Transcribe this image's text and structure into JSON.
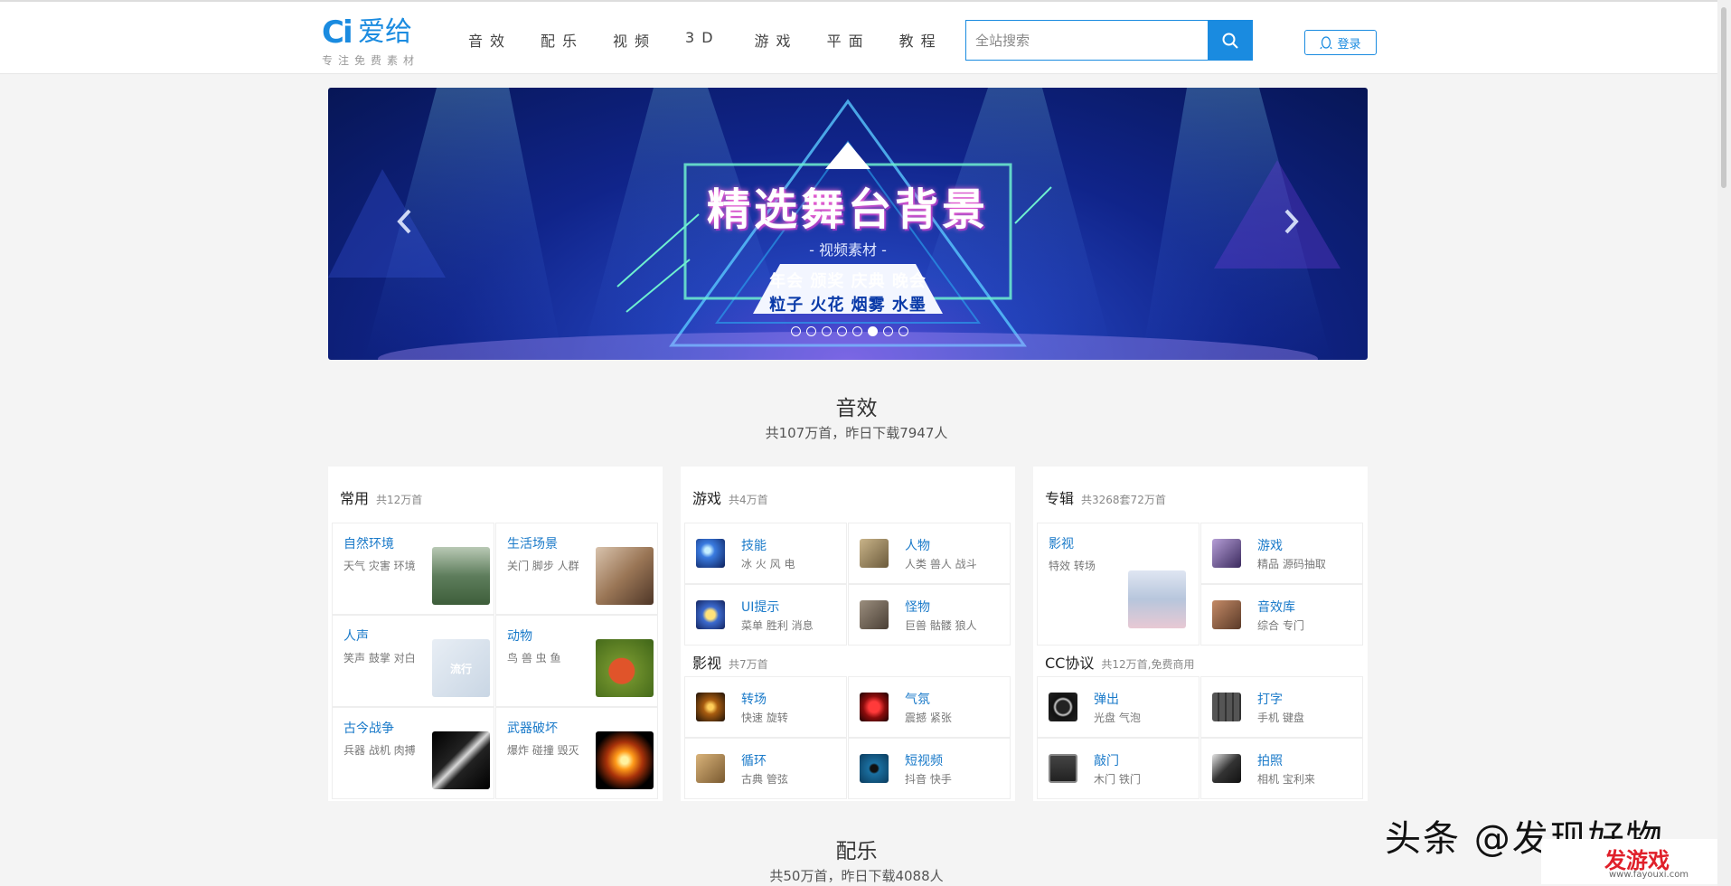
{
  "header": {
    "logo_mark": "Ci",
    "logo_name": "爱给",
    "logo_sub": "专注免费素材",
    "nav": [
      "音效",
      "配乐",
      "视频",
      "3D",
      "游戏",
      "平面",
      "教程"
    ],
    "search_placeholder": "全站搜索",
    "login_label": "登录"
  },
  "banner": {
    "title": "精选舞台背景",
    "subtitle": "- 视频素材 -",
    "tags_line1": "年会 颁奖 庆典 晚会",
    "tags_line2": "粒子 火花 烟雾 水墨",
    "dots_count": 8,
    "active_dot": 6
  },
  "section_sound": {
    "title": "音效",
    "subtitle": "共107万首，昨日下载7947人"
  },
  "section_music": {
    "title": "配乐",
    "subtitle": "共50万首，昨日下载4088人"
  },
  "card_common": {
    "title": "常用",
    "count": "共12万首",
    "items": [
      {
        "title": "自然环境",
        "tags": "天气 灾害 环境"
      },
      {
        "title": "生活场景",
        "tags": "关门 脚步 人群"
      },
      {
        "title": "人声",
        "tags": "笑声 鼓掌 对白",
        "thumb_text": "流行"
      },
      {
        "title": "动物",
        "tags": "鸟 兽 虫 鱼"
      },
      {
        "title": "古今战争",
        "tags": "兵器 战机 肉搏"
      },
      {
        "title": "武器破坏",
        "tags": "爆炸 碰撞 毁灭"
      }
    ]
  },
  "card_game": {
    "title": "游戏",
    "count": "共4万首",
    "items": [
      {
        "title": "技能",
        "tags": "冰 火 风 电"
      },
      {
        "title": "人物",
        "tags": "人类 兽人 战斗"
      },
      {
        "title": "UI提示",
        "tags": "菜单 胜利 消息"
      },
      {
        "title": "怪物",
        "tags": "巨兽 骷髅 狼人"
      }
    ],
    "sub_title": "影视",
    "sub_count": "共7万首",
    "sub_items": [
      {
        "title": "转场",
        "tags": "快速 旋转"
      },
      {
        "title": "气氛",
        "tags": "震撼 紧张"
      },
      {
        "title": "循环",
        "tags": "古典 管弦"
      },
      {
        "title": "短视频",
        "tags": "抖音 快手"
      }
    ]
  },
  "card_album": {
    "title": "专辑",
    "count": "共3268套72万首",
    "feature": {
      "title": "影视",
      "tags": "特效 转场"
    },
    "items": [
      {
        "title": "游戏",
        "tags": "精品 源码抽取"
      },
      {
        "title": "音效库",
        "tags": "综合 专门"
      }
    ],
    "sub_title": "CC协议",
    "sub_count": "共12万首,免费商用",
    "sub_items": [
      {
        "title": "弹出",
        "tags": "光盘 气泡"
      },
      {
        "title": "打字",
        "tags": "手机 键盘"
      },
      {
        "title": "敲门",
        "tags": "木门 铁门"
      },
      {
        "title": "拍照",
        "tags": "相机 宝利来"
      }
    ]
  },
  "watermark": {
    "text": "头条 @发现好物",
    "logo_text": "发游戏",
    "logo_url": "www.fayouxi.com"
  },
  "colors": {
    "accent": "#1a8be0",
    "link": "#1a7ac9"
  }
}
